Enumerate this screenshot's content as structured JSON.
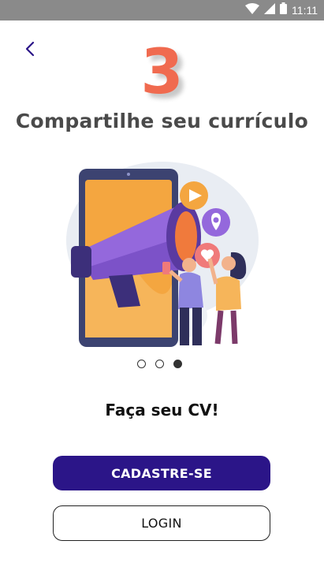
{
  "status_bar": {
    "time": "11:11",
    "icons": [
      "wifi-icon",
      "signal-icon",
      "battery-icon"
    ]
  },
  "onboarding": {
    "step_number": "3",
    "title": "Compartilhe seu currículo",
    "subtitle": "Faça seu CV!",
    "pager": {
      "total": 3,
      "active_index": 2
    }
  },
  "actions": {
    "signup_label": "CADASTRE-SE",
    "login_label": "LOGIN"
  },
  "colors": {
    "accent": "#2b1588",
    "step_number": "#f06a4f",
    "title": "#4a4a4a",
    "status_bar": "#8a8a8a"
  }
}
